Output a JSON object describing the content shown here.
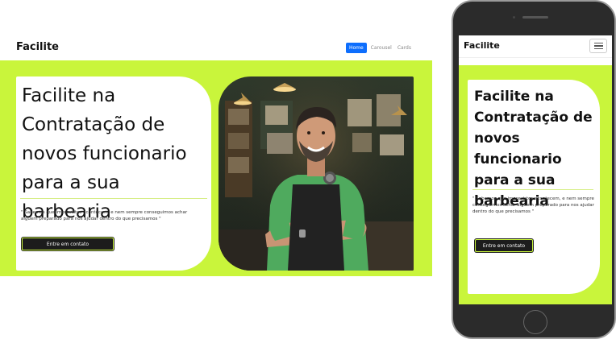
{
  "desktop": {
    "brand": "Facilite",
    "nav": [
      "Home",
      "Carousel",
      "Cards"
    ],
    "hero": {
      "title": "Facilite na Contratação de novos funcionario para a sua barbearia",
      "quote": "\" Sabemos que imprevistos acontecem, e nem sempre conseguimos achar alguem preparado para nos ajudar dentro do que precisamos \"",
      "cta": "Entre em contato"
    }
  },
  "mobile": {
    "brand": "Facilite",
    "hero": {
      "title": "Facilite na Contratação de novos funcionario para a sua barbearia",
      "quote": "\" Sabemos que imprevistos acontecem, e nem sempre conseguimos achar alguem preparado para nos ajudar dentro do que precisamos \"",
      "cta": "Entre em contato"
    }
  },
  "colors": {
    "accent": "#c9f53b",
    "nav_active": "#0d6efd",
    "button": "#1c1c1c"
  },
  "icons": [
    "hamburger-icon"
  ]
}
